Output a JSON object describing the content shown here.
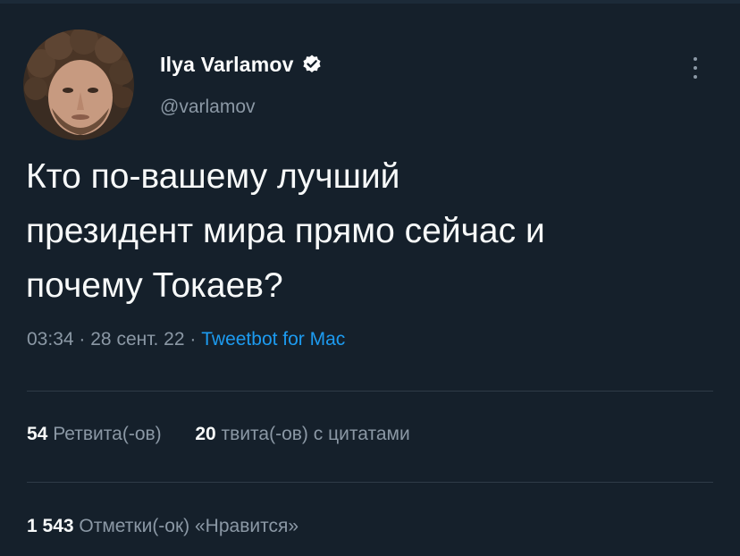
{
  "tweet": {
    "author": {
      "name": "Ilya Varlamov",
      "handle": "@varlamov",
      "verified": true,
      "avatar_icon": "avatar-photo"
    },
    "text_lines": [
      "Кто по-вашему лучший",
      "президент мира прямо сейчас и",
      "почему Токаев?"
    ],
    "time": "03:34",
    "date": "28 сент. 22",
    "separator": "·",
    "source": "Tweetbot for Mac",
    "stats": {
      "retweets_count": "54",
      "retweets_label": "Ретвита(-ов)",
      "quotes_count": "20",
      "quotes_label": "твита(-ов) с цитатами",
      "likes_count": "1 543",
      "likes_label": "Отметки(-ок) «Нравится»"
    }
  },
  "colors": {
    "background": "#15202b",
    "primary_text": "#f7f9f9",
    "secondary_text": "#8b98a5",
    "link": "#1d9bf0",
    "divider": "#2f3b47"
  },
  "icons": {
    "verified": "verified-badge-icon",
    "more": "more-vertical-icon"
  }
}
